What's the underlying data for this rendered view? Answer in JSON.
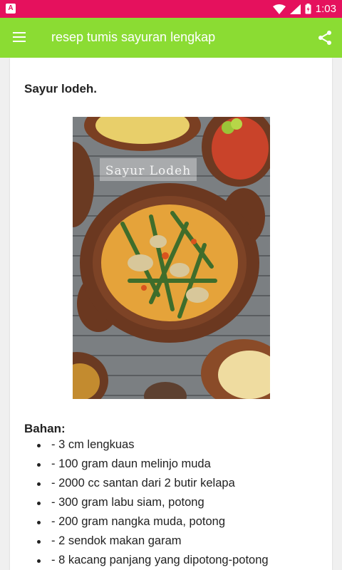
{
  "status_bar": {
    "app_icon": "A",
    "time": "1:03",
    "icons": [
      "wifi-icon",
      "signal-icon",
      "battery-icon"
    ],
    "color": "#e5115d"
  },
  "app_bar": {
    "title": "resep tumis sayuran lengkap",
    "menu_icon": "menu-icon",
    "share_icon": "share-icon",
    "color": "#8bdc33"
  },
  "recipe": {
    "title": "Sayur lodeh.",
    "image_caption": "Sayur Lodeh",
    "ingredients_title": "Bahan:",
    "ingredients": [
      "- 3 cm lengkuas",
      "- 100 gram daun melinjo muda",
      "- 2000 cc santan dari 2 butir kelapa",
      "- 300 gram labu siam, potong",
      "- 200 gram nangka muda, potong",
      "- 2 sendok makan garam",
      "- 8 kacang panjang yang dipotong-potong"
    ]
  }
}
